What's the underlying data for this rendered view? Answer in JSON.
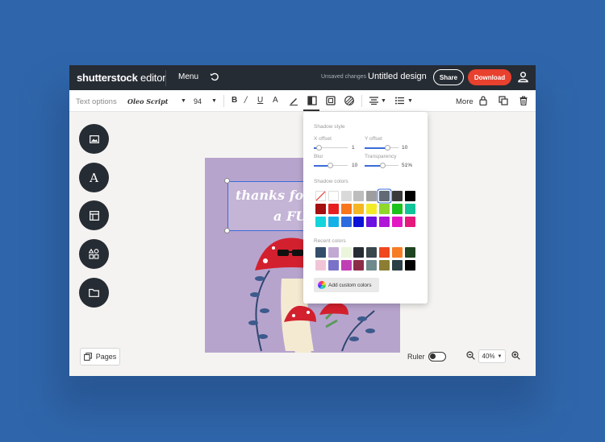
{
  "app": {
    "logo_main": "shutterstock",
    "logo_sub": " editor",
    "menu_label": "Menu",
    "unsaved_label": "Unsaved changes",
    "design_title": "Untitled design",
    "share_label": "Share",
    "download_label": "Download"
  },
  "toolbar": {
    "text_options_label": "Text options",
    "font_name": "Oleo Script",
    "font_size": "94",
    "more_label": "More"
  },
  "canvas": {
    "line1": "thanks for",
    "line2": "a FU"
  },
  "shadow_panel": {
    "style_heading": "Shadow style",
    "x_offset_label": "X offset",
    "x_offset_value": "1",
    "y_offset_label": "Y offset",
    "y_offset_value": "10",
    "blur_label": "Blur",
    "blur_value": "10",
    "transparency_label": "Transparency",
    "transparency_value": "51%",
    "colors_heading": "Shadow colors",
    "recent_heading": "Recent colors",
    "add_custom_label": "Add custom colors",
    "shadow_colors": [
      [
        "none",
        "#ffffff",
        "#d9d9d9",
        "#bdbdbd",
        "#9e9e9e",
        "#616a75",
        "#3a3a3a",
        "#000000"
      ],
      [
        "#a50f0f",
        "#e62020",
        "#f7761b",
        "#f4b623",
        "#f3eb28",
        "#8fd72a",
        "#1bc21b",
        "#12c49a"
      ],
      [
        "#14d4db",
        "#14b1e8",
        "#2d6ae0",
        "#0b12d8",
        "#6b12e2",
        "#b016d8",
        "#e316c4",
        "#e5197c"
      ]
    ],
    "selected_shadow_color": "#616a75",
    "recent_colors": [
      [
        "#344d6a",
        "#c1a9d3",
        "#eaf5db",
        "#262c33",
        "#3a474d",
        "#f0471f",
        "#f77d24",
        "#1f4420"
      ],
      [
        "#f0c6d7",
        "#7a72c9",
        "#c13fb4",
        "#8c2d48",
        "#6e8a8d",
        "#8b7d32",
        "#2b3f44",
        "#000000"
      ]
    ]
  },
  "bottom": {
    "pages_label": "Pages",
    "ruler_label": "Ruler",
    "zoom_value": "40%"
  }
}
